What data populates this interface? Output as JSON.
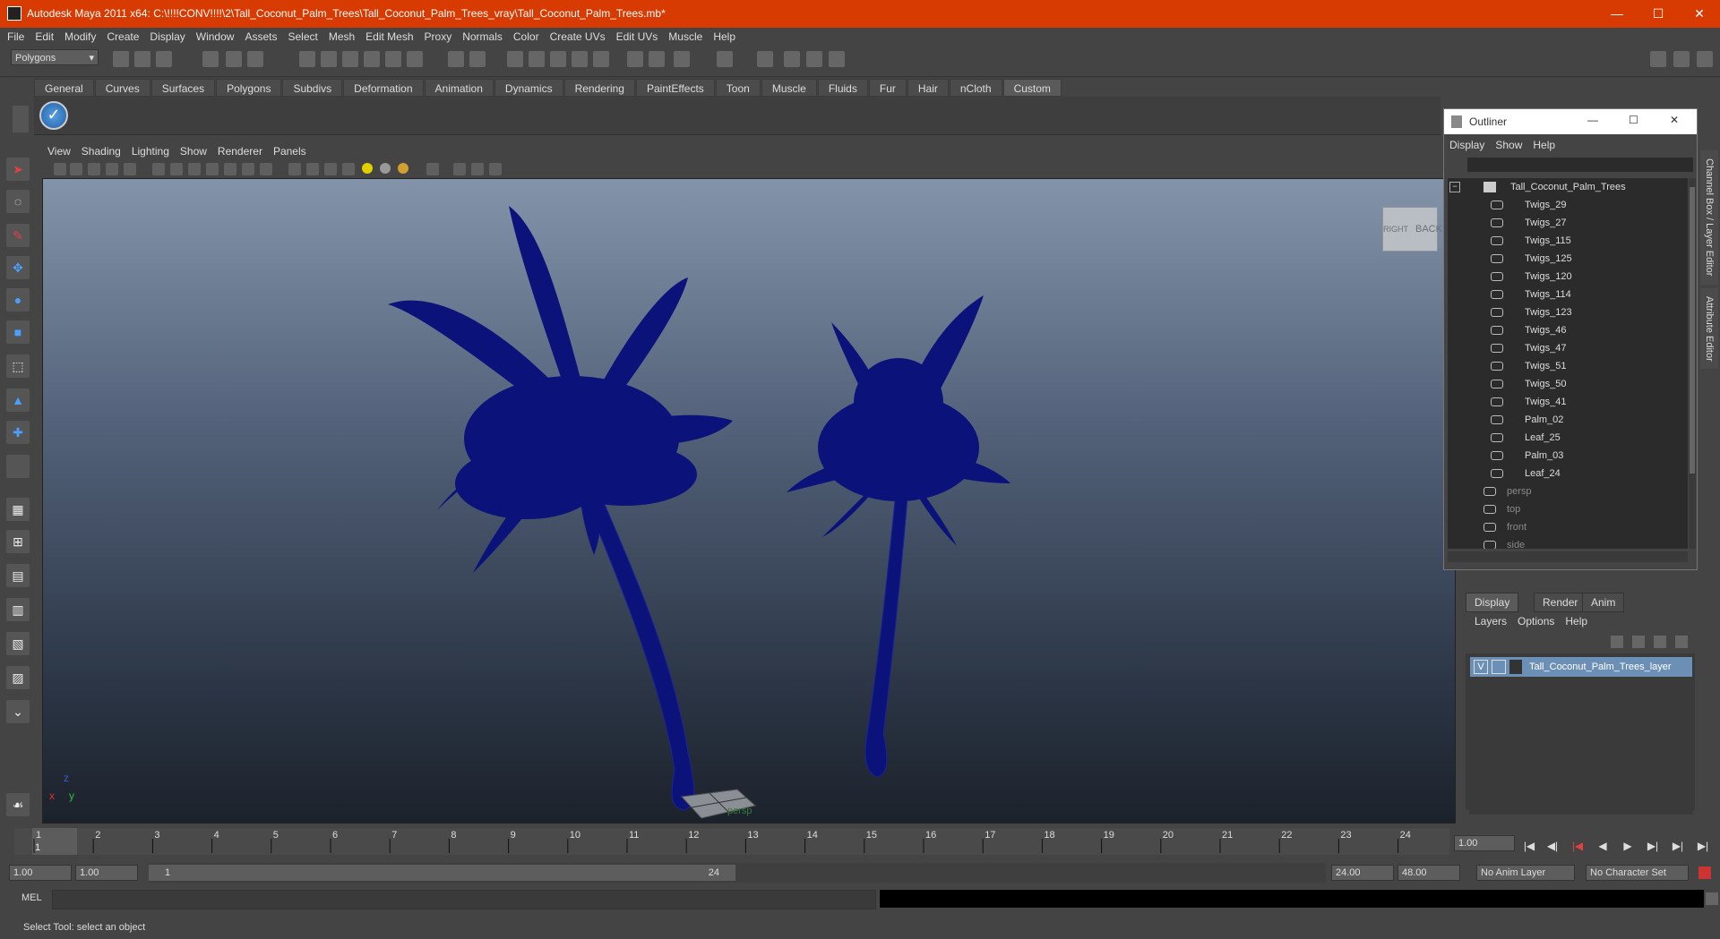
{
  "window": {
    "title": "Autodesk Maya 2011 x64: C:\\!!!!CONV!!!!\\2\\Tall_Coconut_Palm_Trees\\Tall_Coconut_Palm_Trees_vray\\Tall_Coconut_Palm_Trees.mb*",
    "minimize": "—",
    "maximize": "☐",
    "close": "✕"
  },
  "menubar": [
    "File",
    "Edit",
    "Modify",
    "Create",
    "Display",
    "Window",
    "Assets",
    "Select",
    "Mesh",
    "Edit Mesh",
    "Proxy",
    "Normals",
    "Color",
    "Create UVs",
    "Edit UVs",
    "Muscle",
    "Help"
  ],
  "mode_selector": "Polygons",
  "shelf_tabs": [
    "General",
    "Curves",
    "Surfaces",
    "Polygons",
    "Subdivs",
    "Deformation",
    "Animation",
    "Dynamics",
    "Rendering",
    "PaintEffects",
    "Toon",
    "Muscle",
    "Fluids",
    "Fur",
    "Hair",
    "nCloth",
    "Custom"
  ],
  "active_shelf_tab": "Custom",
  "panel_menu": [
    "View",
    "Shading",
    "Lighting",
    "Show",
    "Renderer",
    "Panels"
  ],
  "viewport": {
    "camera_label": "persp",
    "viewcube_faces": [
      "RIGHT",
      "BACK"
    ],
    "axis_labels": {
      "x": "x",
      "y": "y",
      "z": "z"
    }
  },
  "outliner": {
    "title": "Outliner",
    "menu": [
      "Display",
      "Show",
      "Help"
    ],
    "root": "Tall_Coconut_Palm_Trees",
    "items": [
      "Twigs_29",
      "Twigs_27",
      "Twigs_115",
      "Twigs_125",
      "Twigs_120",
      "Twigs_114",
      "Twigs_123",
      "Twigs_46",
      "Twigs_47",
      "Twigs_51",
      "Twigs_50",
      "Twigs_41",
      "Palm_02",
      "Leaf_25",
      "Palm_03",
      "Leaf_24"
    ],
    "cameras": [
      "persp",
      "top",
      "front",
      "side"
    ]
  },
  "side_tabs": [
    "Channel Box / Layer Editor",
    "Attribute Editor"
  ],
  "layer_editor": {
    "tabs": [
      "Display",
      "Render",
      "Anim"
    ],
    "active_tab": "Display",
    "menu": [
      "Layers",
      "Options",
      "Help"
    ],
    "layers": [
      {
        "visible": "V",
        "name": "Tall_Coconut_Palm_Trees_layer"
      }
    ]
  },
  "timeline": {
    "ticks": [
      "1",
      "2",
      "3",
      "4",
      "5",
      "6",
      "7",
      "8",
      "9",
      "10",
      "11",
      "12",
      "13",
      "14",
      "15",
      "16",
      "17",
      "18",
      "19",
      "20",
      "21",
      "22",
      "23",
      "24"
    ],
    "current_frame_marker": "1",
    "current_time": "1.00"
  },
  "range": {
    "start": "1.00",
    "playback_start": "1.00",
    "slider_start": "1",
    "slider_end": "24",
    "playback_end": "24.00",
    "end": "48.00",
    "anim_layer": "No Anim Layer",
    "character_set": "No Character Set"
  },
  "command_line": {
    "label": "MEL"
  },
  "help_line": "Select Tool: select an object",
  "colors": {
    "title_bar": "#d83b01",
    "wireframe": "#0b137a",
    "layer_highlight": "#6b8fb5"
  }
}
